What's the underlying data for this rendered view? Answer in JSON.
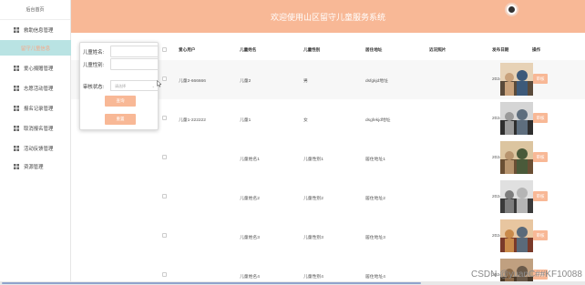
{
  "sidebar": {
    "top_label": "后台首页",
    "items": [
      {
        "label": "救助信息管理",
        "icon": "grid-icon"
      },
      {
        "label": "留守儿童信息",
        "icon": "",
        "active": true
      },
      {
        "label": "爱心捐赠管理",
        "icon": "grid-icon"
      },
      {
        "label": "志愿活动管理",
        "icon": "grid-icon"
      },
      {
        "label": "报名记录管理",
        "icon": "grid-icon"
      },
      {
        "label": "取消报名管理",
        "icon": "grid-icon"
      },
      {
        "label": "活动反馈管理",
        "icon": "grid-icon"
      },
      {
        "label": "资源管理",
        "icon": "grid-icon"
      }
    ]
  },
  "header": {
    "title": "欢迎使用山区留守儿童服务系统",
    "avatar_icon": "user-avatar-icon"
  },
  "search": {
    "name_label": "儿童姓名:",
    "gender_label": "儿童性别:",
    "status_label": "审核状态:",
    "status_placeholder": "请选择",
    "search_button": "查询",
    "reset_button": "重置"
  },
  "table": {
    "headers": [
      "爱心用户",
      "儿童姓名",
      "儿童性别",
      "居住地址",
      "近况照片",
      "发布日期",
      "操作"
    ],
    "rows": [
      {
        "user": "儿童2-666666",
        "name": "儿童2",
        "gender": "男",
        "address": "dsfgkjd地址",
        "date": "2024-03-02",
        "op": "审核"
      },
      {
        "user": "儿童1-222222",
        "name": "儿童1",
        "gender": "女",
        "address": "dsgfekjd地址",
        "date": "2024-03-02",
        "op": "审核"
      },
      {
        "user": "",
        "name": "儿童姓名1",
        "gender": "儿童性别1",
        "address": "居住地址1",
        "date": "2024-03-02",
        "op": "审核"
      },
      {
        "user": "",
        "name": "儿童姓名2",
        "gender": "儿童性别2",
        "address": "居住地址2",
        "date": "2024-03-02",
        "op": "审核"
      },
      {
        "user": "",
        "name": "儿童姓名3",
        "gender": "儿童性别3",
        "address": "居住地址3",
        "date": "2024-03-02",
        "op": "审核"
      },
      {
        "user": "",
        "name": "儿童姓名4",
        "gender": "儿童性别4",
        "address": "居住地址4",
        "date": "2024-03-02",
        "op": "审核"
      }
    ]
  },
  "watermark": "CSDN @yuanC##KF10088",
  "colors": {
    "accent": "#f8b896",
    "active_bg": "#b9e3e3"
  }
}
